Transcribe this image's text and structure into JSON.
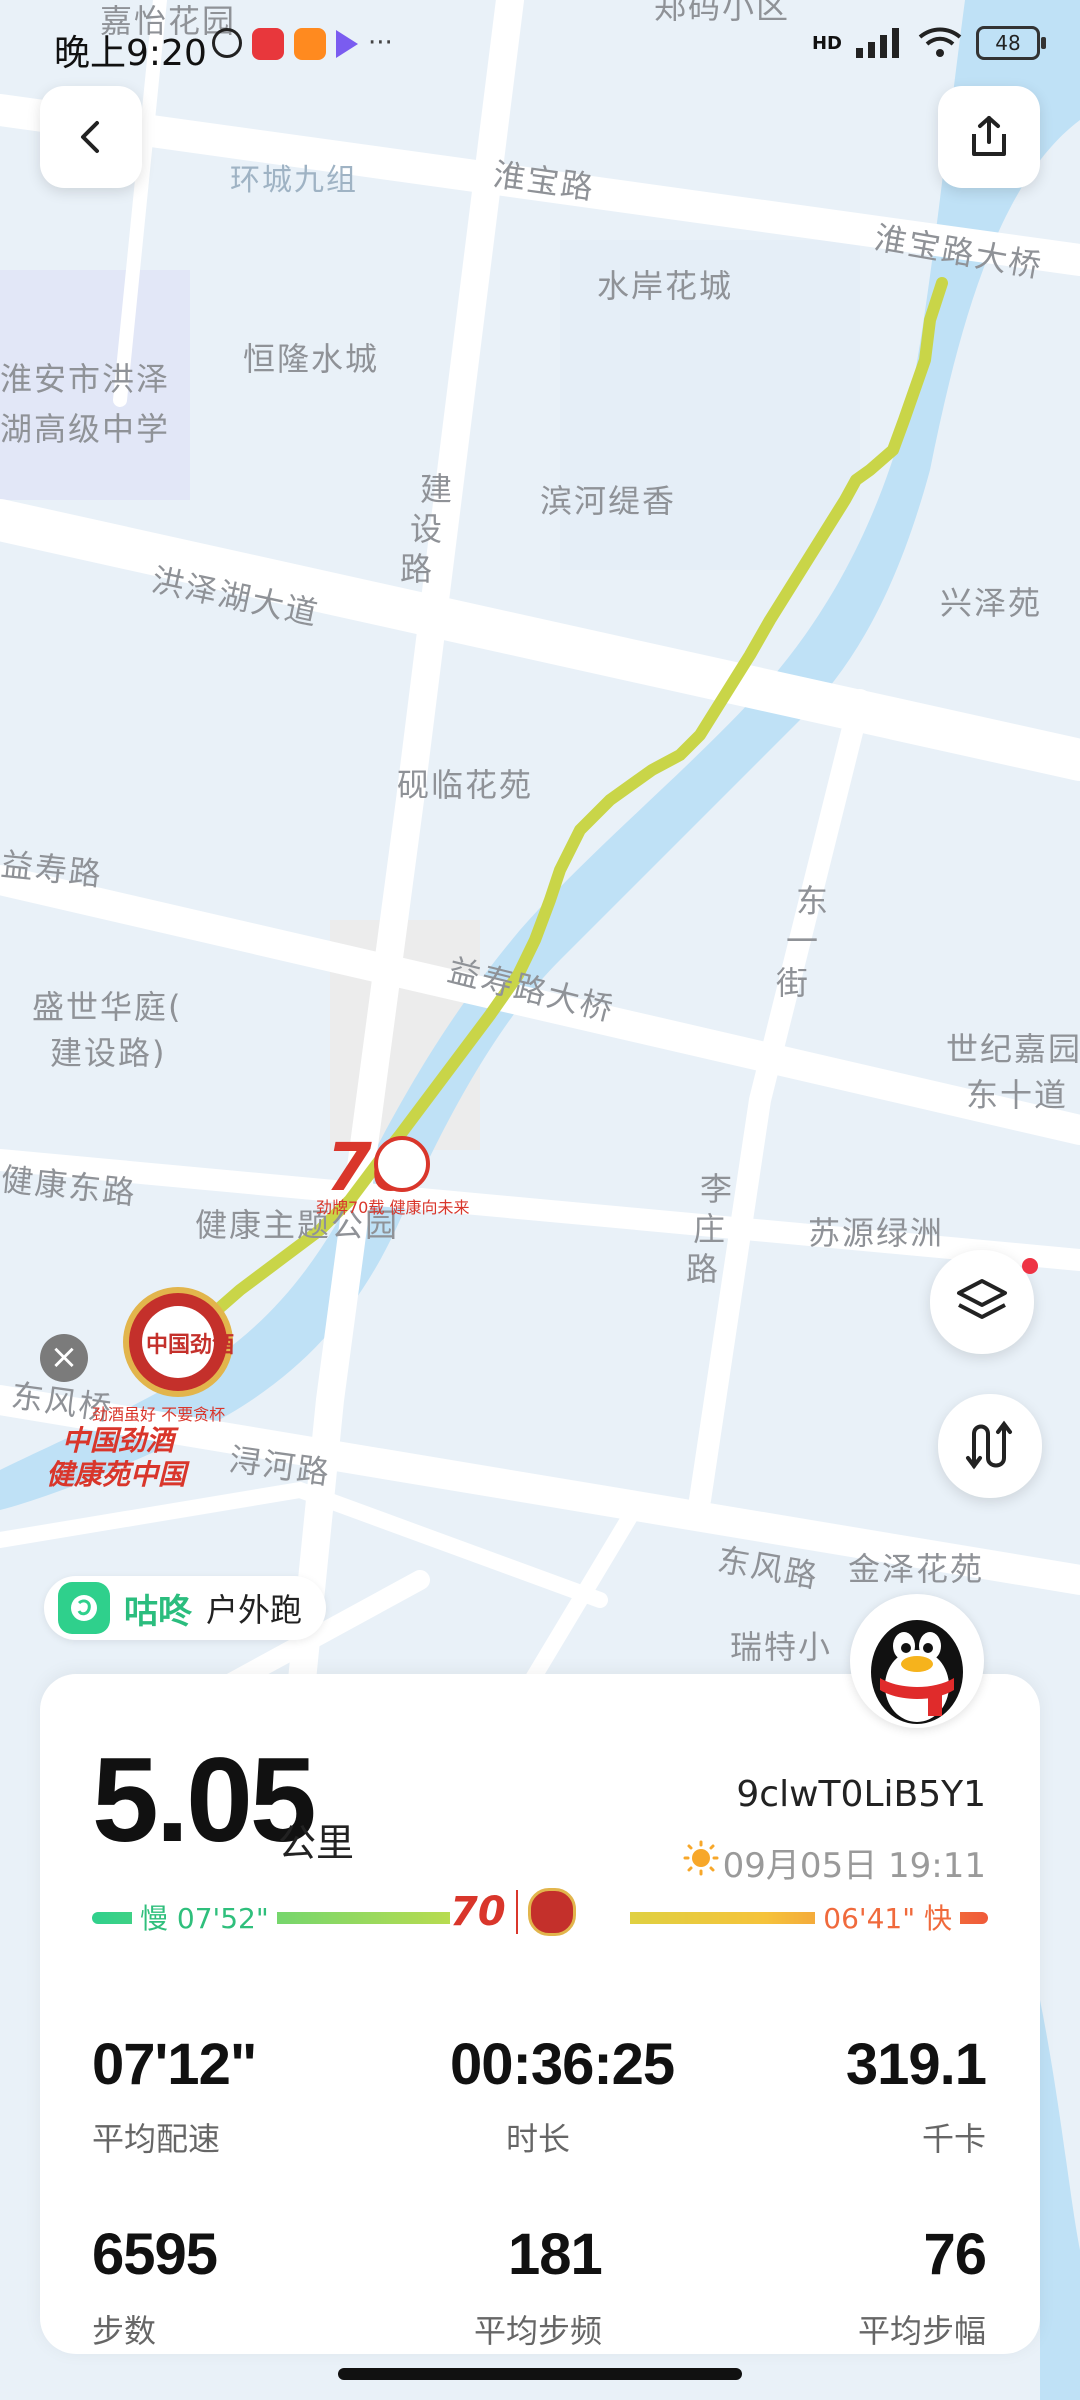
{
  "status_bar": {
    "time": "晚上9:20",
    "network": "HD",
    "battery": "48"
  },
  "map": {
    "labels": [
      "嘉怡花园",
      "郑码小区",
      "环城九组",
      "淮宝路",
      "淮宝路大桥",
      "水岸花城",
      "恒隆水城",
      "淮安市洪泽",
      "湖高级中学",
      "滨河缇香",
      "建设路",
      "洪泽湖大道",
      "兴泽苑",
      "砚临花苑",
      "益寿路",
      "东一街",
      "益寿路大桥",
      "盛世华庭(",
      "建设路)",
      "世纪嘉园",
      "东十道",
      "健康东路",
      "健康主题公园",
      "李庄路",
      "苏源绿洲",
      "东风桥",
      "浔河路",
      "东风路",
      "金泽花苑",
      "瑞特小"
    ],
    "ad_texts": [
      "劲牌70载 健康向未来",
      "中国劲酒",
      "健康苑中国",
      "劲酒虽好 不要贪杯"
    ]
  },
  "brand": {
    "name": "咕咚",
    "activity": "户外跑"
  },
  "summary": {
    "distance": "5.05",
    "distance_unit": "公里",
    "user_id": "9clwT0LiB5Y1",
    "datetime": "09月05日 19:11",
    "pace_slow_label": "慢 07'52\"",
    "pace_fast_label": "06'41\" 快"
  },
  "stats": [
    {
      "value": "07'12\"",
      "label": "平均配速"
    },
    {
      "value": "00:36:25",
      "label": "时长"
    },
    {
      "value": "319.1",
      "label": "千卡"
    },
    {
      "value": "6595",
      "label": "步数"
    },
    {
      "value": "181",
      "label": "平均步频"
    },
    {
      "value": "76",
      "label": "平均步幅"
    }
  ],
  "colors": {
    "route": "#c9d548",
    "river": "#bfe1f6",
    "accent_green": "#2bbd7e",
    "pace_slow": "#2fbf7c",
    "pace_fast": "#f06a3c"
  },
  "icons": {
    "back": "chevron-left-icon",
    "share": "share-icon",
    "layers": "layers-icon",
    "route_toggle": "route-icon",
    "close": "close-icon",
    "weather": "sun-icon"
  }
}
